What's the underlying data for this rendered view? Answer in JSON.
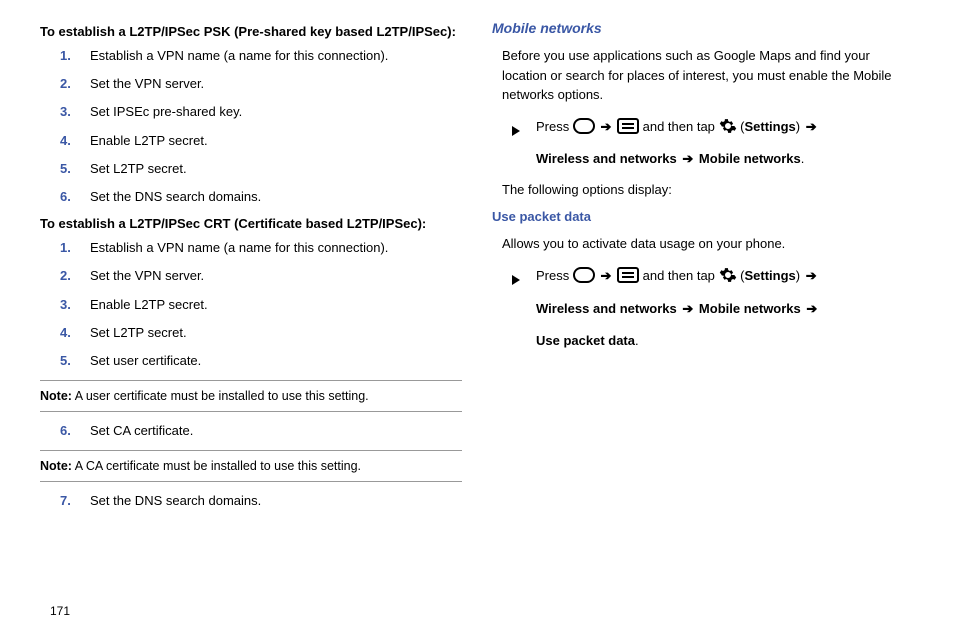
{
  "left": {
    "heading_psk": "To establish a L2TP/IPSec PSK (Pre-shared key based L2TP/IPSec):",
    "psk_steps": [
      "Establish a VPN name (a name for this connection).",
      "Set the VPN server.",
      "Set IPSEc pre-shared key.",
      "Enable L2TP secret.",
      "Set L2TP secret.",
      "Set the DNS search domains."
    ],
    "heading_crt": "To establish a L2TP/IPSec CRT (Certificate based L2TP/IPSec):",
    "crt_steps_a": [
      "Establish a VPN name (a name for this connection).",
      "Set the VPN server.",
      "Enable L2TP secret.",
      "Set L2TP secret.",
      "Set user certificate."
    ],
    "note1_label": "Note:",
    "note1_text": " A user certificate must be installed to use this setting.",
    "crt_step6_num": "6.",
    "crt_step6": "Set CA certificate.",
    "note2_label": "Note:",
    "note2_text": " A CA certificate must be installed to use this setting.",
    "crt_step7_num": "7.",
    "crt_step7": "Set the DNS search domains."
  },
  "right": {
    "mobile_heading": "Mobile networks",
    "intro": "Before you use applications such as Google Maps and find your location or search for places of interest, you must enable the Mobile networks options.",
    "press": "Press ",
    "and_then_tap": " and then tap ",
    "settings": "Settings",
    "wnet": "Wireless and networks",
    "mnet": "Mobile networks",
    "following": "The following options display:",
    "use_packet_heading": "Use packet data",
    "allows": "Allows you to activate data usage on your phone.",
    "upd": "Use packet data"
  },
  "page": "171"
}
